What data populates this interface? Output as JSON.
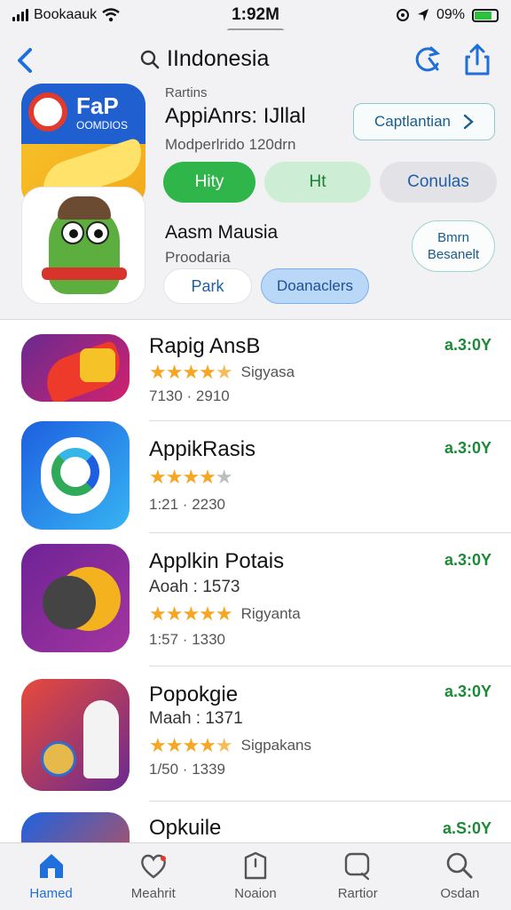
{
  "status_bar": {
    "carrier": "Booka",
    "network": "auk",
    "time": "1:92M",
    "battery_text": "09%"
  },
  "nav": {
    "search_text": "IIndonesia"
  },
  "featured": {
    "app1": {
      "icon_title": "FaP",
      "icon_sub": "OOMDIOS",
      "category": "Rartins",
      "title": "AppiAnrs: IJllal",
      "subtitle": "Modperlrido 120drn",
      "button_label": "Captlantian"
    },
    "pills": [
      "Hity",
      "Ht",
      "Conulas"
    ],
    "app2": {
      "name": "Aasm Mausia",
      "category": "Proodaria",
      "side_button_line1": "Bmrn",
      "side_button_line2": "Besanelt"
    },
    "pills2": [
      "Park",
      "Doanaclers"
    ]
  },
  "apps": [
    {
      "name": "Rapig AnsB",
      "meta": "",
      "rating": 4.5,
      "rating_label": "Sigyasa",
      "range": "7130 · 2910",
      "price": "a.3:0Y"
    },
    {
      "name": "AppikRasis",
      "meta": "",
      "rating": 3.5,
      "rating_label": "",
      "range": "1:21 · 2230",
      "price": "a.3:0Y"
    },
    {
      "name": "Applkin Potais",
      "meta": "Aoah  :  1573",
      "rating": 5,
      "rating_label": "Rigyanta",
      "range": "1:57 · 1330",
      "price": "a.3:0Y"
    },
    {
      "name": "Popokgie",
      "meta": "Maah  :  1371",
      "rating": 4.5,
      "rating_label": "Sigpakans",
      "range": "1/50 · 1339",
      "price": "a.3:0Y"
    },
    {
      "name": "Opkuile",
      "meta": "",
      "rating": 0,
      "rating_label": "",
      "range": "",
      "price": "a.S:0Y"
    }
  ],
  "tabs": [
    {
      "label": "Hamed",
      "icon": "home-icon",
      "active": true
    },
    {
      "label": "Meahrit",
      "icon": "heart-icon",
      "active": false
    },
    {
      "label": "Noaion",
      "icon": "tag-icon",
      "active": false
    },
    {
      "label": "Rartior",
      "icon": "chat-icon",
      "active": false
    },
    {
      "label": "Osdan",
      "icon": "search-icon",
      "active": false
    }
  ],
  "colors": {
    "accent": "#1f6fdc",
    "price": "#1c8a36",
    "star": "#f5a623",
    "pill_green": "#2fb54a"
  }
}
